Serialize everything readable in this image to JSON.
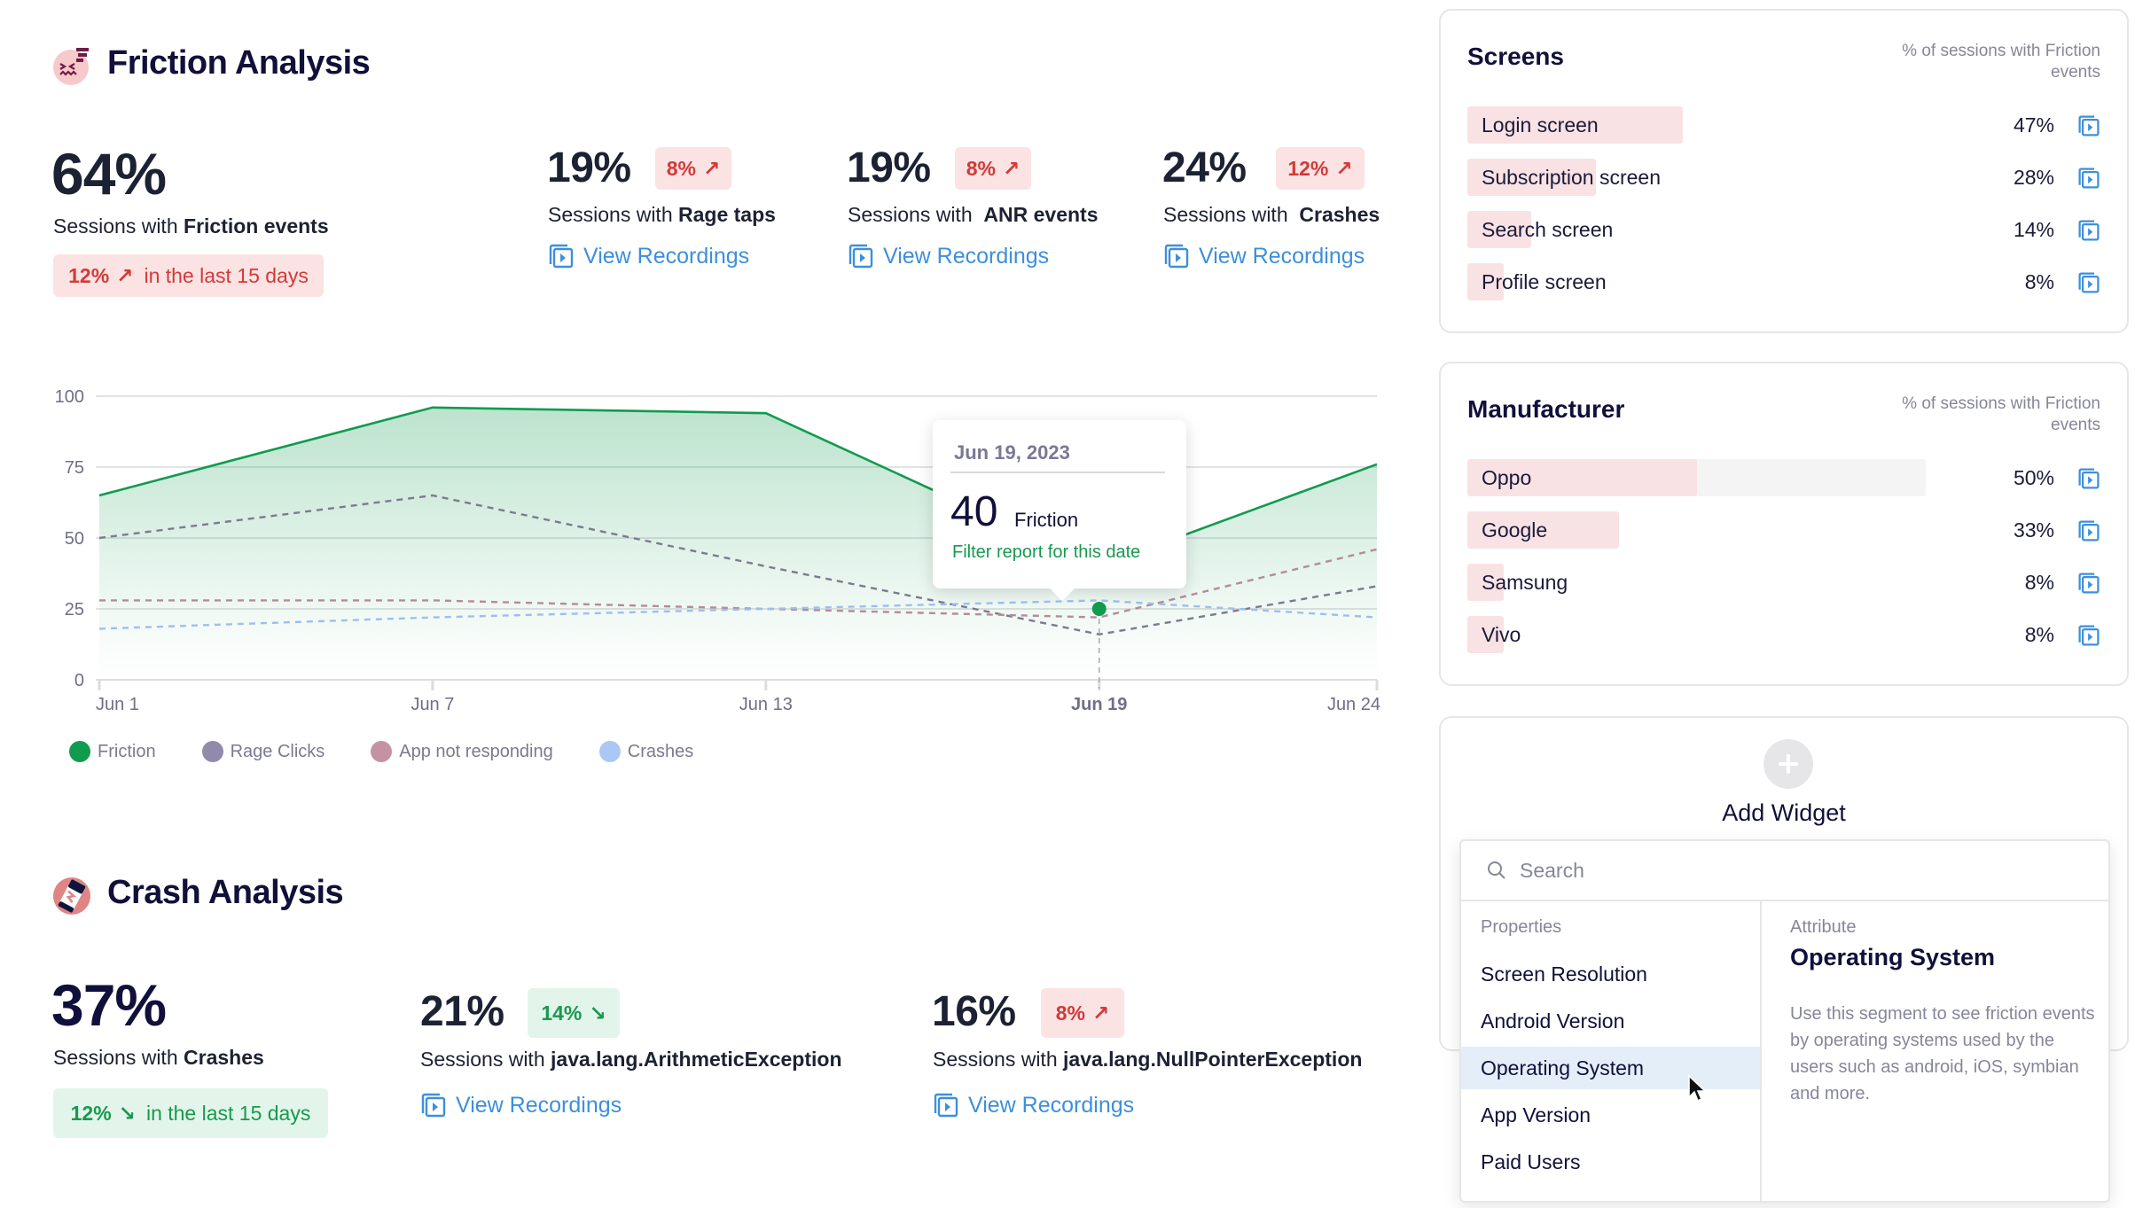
{
  "friction": {
    "title": "Friction Analysis",
    "icon": "frustrated-face-icon",
    "main": {
      "value": "64%",
      "label_prefix": "Sessions with",
      "label_bold": "Friction events",
      "trend_value": "12%",
      "trend_direction": "up",
      "trend_suffix": "in the last 15 days"
    },
    "stats": [
      {
        "value": "19%",
        "badge": "8%",
        "direction": "up",
        "label_prefix": "Sessions with",
        "label_bold": "Rage taps",
        "link": "View Recordings"
      },
      {
        "value": "19%",
        "badge": "8%",
        "direction": "up",
        "label_prefix": "Sessions with",
        "label_bold": "ANR events",
        "link": "View Recordings"
      },
      {
        "value": "24%",
        "badge": "12%",
        "direction": "up",
        "label_prefix": "Sessions with",
        "label_bold": "Crashes",
        "link": "View Recordings"
      }
    ]
  },
  "chart_data": {
    "type": "area",
    "title": "",
    "xlabel": "",
    "ylabel": "",
    "x": [
      "Jun 1",
      "Jun 7",
      "Jun 13",
      "Jun 19",
      "Jun 24"
    ],
    "x_days": [
      1,
      7,
      13,
      19,
      24
    ],
    "ylim": [
      0,
      100
    ],
    "yticks": [
      0,
      25,
      50,
      75,
      100
    ],
    "grid": true,
    "highlighted_x": "Jun 19",
    "series": [
      {
        "name": "Friction",
        "style": "area-solid",
        "color": "#109b4f",
        "values": [
          65,
          96,
          94,
          40,
          76
        ],
        "marker_value": 25
      },
      {
        "name": "Rage Clicks",
        "style": "dashed",
        "color": "#7d7a8e",
        "values": [
          50,
          65,
          40,
          16,
          33
        ]
      },
      {
        "name": "App not responding",
        "style": "dashed",
        "color": "#b48c96",
        "values": [
          28,
          28,
          25,
          22,
          46
        ]
      },
      {
        "name": "Crashes",
        "style": "dashed",
        "color": "#9dbfee",
        "values": [
          18,
          22,
          25,
          28,
          22
        ]
      }
    ],
    "legend": [
      {
        "label": "Friction",
        "color": "#109b4f"
      },
      {
        "label": "Rage Clicks",
        "color": "#918aaa"
      },
      {
        "label": "App not responding",
        "color": "#c493a3"
      },
      {
        "label": "Crashes",
        "color": "#a9c8f3"
      }
    ],
    "legend_position": "bottom-left",
    "tooltip": {
      "date": "Jun 19, 2023",
      "value": "40",
      "series": "Friction",
      "link": "Filter report for this date"
    }
  },
  "crash": {
    "title": "Crash Analysis",
    "icon": "crash-phone-icon",
    "main": {
      "value": "37%",
      "label_prefix": "Sessions with",
      "label_bold": "Crashes",
      "trend_value": "12%",
      "trend_direction": "down",
      "trend_suffix": "in the last 15 days"
    },
    "stats": [
      {
        "value": "21%",
        "badge": "14%",
        "direction": "down",
        "label_prefix": "Sessions with",
        "label_bold": "java.lang.ArithmeticException",
        "link": "View Recordings"
      },
      {
        "value": "16%",
        "badge": "8%",
        "direction": "up",
        "label_prefix": "Sessions with",
        "label_bold": "java.lang.NullPointerException",
        "link": "View Recordings"
      }
    ]
  },
  "screens": {
    "title": "Screens",
    "note": "% of sessions with Friction events",
    "rows": [
      {
        "label": "Login screen",
        "pct": "47%",
        "value": 47
      },
      {
        "label": "Subscription screen",
        "pct": "28%",
        "value": 28
      },
      {
        "label": "Search screen",
        "pct": "14%",
        "value": 14
      },
      {
        "label": "Profile screen",
        "pct": "8%",
        "value": 8
      }
    ]
  },
  "manufacturer": {
    "title": "Manufacturer",
    "note": "% of sessions with Friction events",
    "rows": [
      {
        "label": "Oppo",
        "pct": "50%",
        "value": 50,
        "hover": true
      },
      {
        "label": "Google",
        "pct": "33%",
        "value": 33
      },
      {
        "label": "Samsung",
        "pct": "8%",
        "value": 8
      },
      {
        "label": "Vivo",
        "pct": "8%",
        "value": 8
      }
    ]
  },
  "add_widget": {
    "title": "Add Widget",
    "search_placeholder": "Search",
    "properties_heading": "Properties",
    "properties": [
      "Screen Resolution",
      "Android Version",
      "Operating System",
      "App Version",
      "Paid Users"
    ],
    "selected": "Operating System",
    "attribute_heading": "Attribute",
    "attribute_title": "Operating System",
    "attribute_description": "Use this segment to see friction events by operating systems used by the users such as android, iOS, symbian and more."
  },
  "colors": {
    "accent_blue": "#3d8fdc",
    "up_red": "#d23a3a",
    "down_green": "#179a4e",
    "bar_pink": "#f9e2e4"
  }
}
